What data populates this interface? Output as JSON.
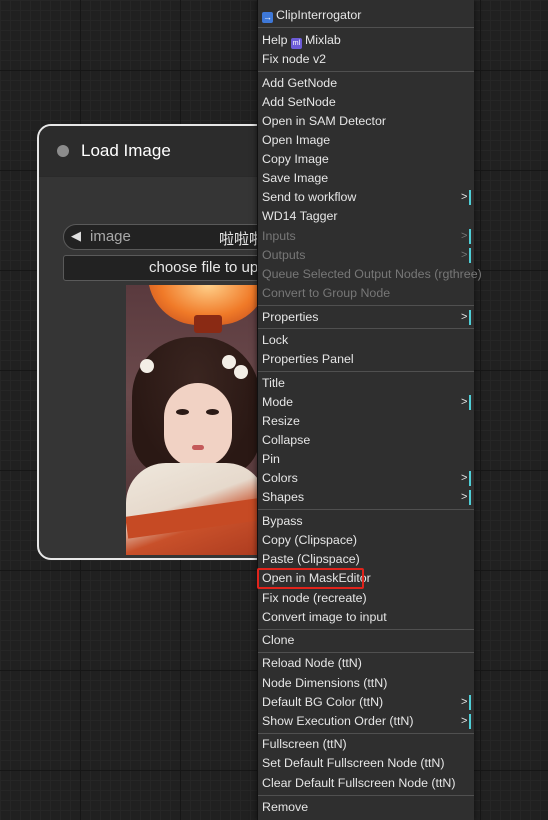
{
  "node": {
    "title": "Load Image",
    "image_widget_label": "image",
    "image_widget_value": "啦啦啦的小",
    "upload_button_label": "choose file to upload"
  },
  "menu": {
    "items": [
      {
        "label": "ClipInterrogator",
        "icon": "clip-icon",
        "disabled": false,
        "submenu": false
      },
      {
        "label": "Help",
        "badge": "Mixlab",
        "disabled": false,
        "submenu": false
      },
      {
        "label": "Fix node v2",
        "disabled": false,
        "submenu": false
      },
      {
        "label": "Add GetNode",
        "disabled": false,
        "submenu": false
      },
      {
        "label": "Add SetNode",
        "disabled": false,
        "submenu": false
      },
      {
        "label": "Open in SAM Detector",
        "disabled": false,
        "submenu": false
      },
      {
        "label": "Open Image",
        "disabled": false,
        "submenu": false
      },
      {
        "label": "Copy Image",
        "disabled": false,
        "submenu": false
      },
      {
        "label": "Save Image",
        "disabled": false,
        "submenu": false
      },
      {
        "label": "Send to workflow",
        "disabled": false,
        "submenu": true
      },
      {
        "label": "WD14 Tagger",
        "disabled": false,
        "submenu": false
      },
      {
        "label": "Inputs",
        "disabled": true,
        "submenu": true
      },
      {
        "label": "Outputs",
        "disabled": true,
        "submenu": true
      },
      {
        "label": "Queue Selected Output Nodes (rgthree)",
        "disabled": true,
        "submenu": false
      },
      {
        "label": "Convert to Group Node",
        "disabled": true,
        "submenu": false
      },
      {
        "label": "Properties",
        "disabled": false,
        "submenu": true
      },
      {
        "label": "Lock",
        "disabled": false,
        "submenu": false
      },
      {
        "label": "Properties Panel",
        "disabled": false,
        "submenu": false
      },
      {
        "label": "Title",
        "disabled": false,
        "submenu": false
      },
      {
        "label": "Mode",
        "disabled": false,
        "submenu": true
      },
      {
        "label": "Resize",
        "disabled": false,
        "submenu": false
      },
      {
        "label": "Collapse",
        "disabled": false,
        "submenu": false
      },
      {
        "label": "Pin",
        "disabled": false,
        "submenu": false
      },
      {
        "label": "Colors",
        "disabled": false,
        "submenu": true
      },
      {
        "label": "Shapes",
        "disabled": false,
        "submenu": true
      },
      {
        "label": "Bypass",
        "disabled": false,
        "submenu": false
      },
      {
        "label": "Copy (Clipspace)",
        "disabled": false,
        "submenu": false
      },
      {
        "label": "Paste (Clipspace)",
        "disabled": false,
        "submenu": false
      },
      {
        "label": "Open in MaskEditor",
        "disabled": false,
        "submenu": false,
        "highlighted": true
      },
      {
        "label": "Fix node (recreate)",
        "disabled": false,
        "submenu": false
      },
      {
        "label": "Convert image to input",
        "disabled": false,
        "submenu": false
      },
      {
        "label": "Clone",
        "disabled": false,
        "submenu": false
      },
      {
        "label": "Reload Node (ttN)",
        "disabled": false,
        "submenu": false
      },
      {
        "label": "Node Dimensions (ttN)",
        "disabled": false,
        "submenu": false
      },
      {
        "label": "Default BG Color (ttN)",
        "disabled": false,
        "submenu": true
      },
      {
        "label": "Show Execution Order (ttN)",
        "disabled": false,
        "submenu": true
      },
      {
        "label": "Fullscreen (ttN)",
        "disabled": false,
        "submenu": false
      },
      {
        "label": "Set Default Fullscreen Node (ttN)",
        "disabled": false,
        "submenu": false
      },
      {
        "label": "Clear Default Fullscreen Node (ttN)",
        "disabled": false,
        "submenu": false
      },
      {
        "label": "Remove",
        "disabled": false,
        "submenu": false
      }
    ],
    "submenu_arrow": ">",
    "accent_color": "#4fd0d8",
    "highlight_color": "#e0241c"
  }
}
